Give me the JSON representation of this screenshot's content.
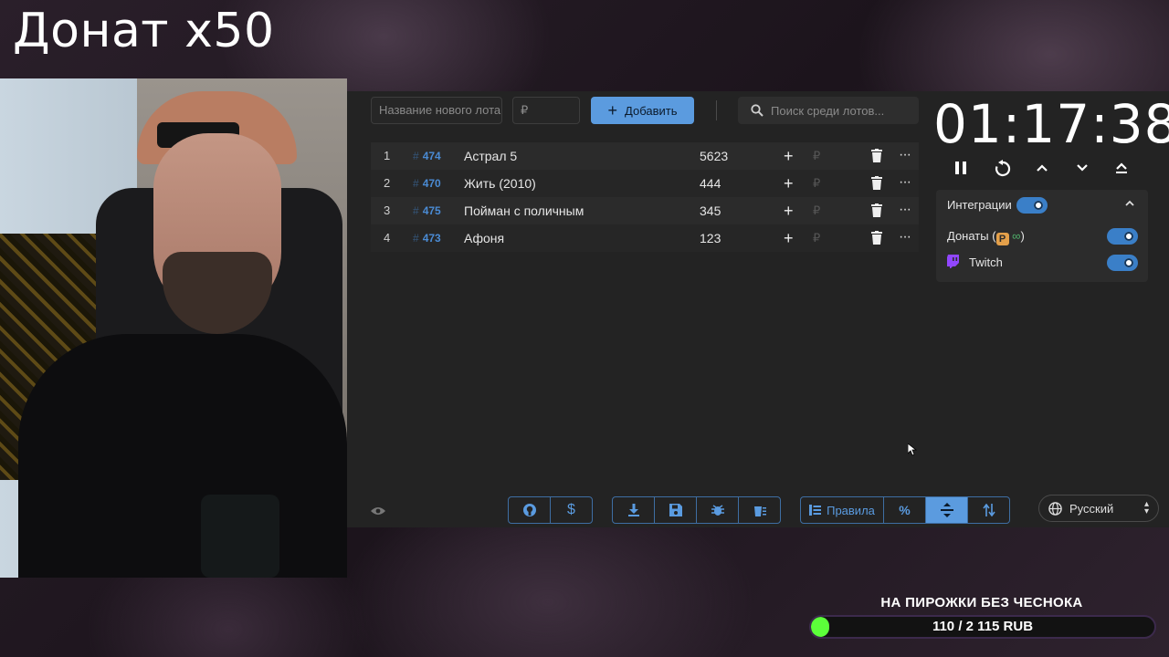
{
  "overlay": {
    "title": "Донат x50"
  },
  "toolbar": {
    "new_lot_placeholder": "Название нового лота",
    "amount_placeholder": "₽",
    "add_label": "Добавить",
    "search_placeholder": "Поиск среди лотов..."
  },
  "lots": [
    {
      "index": "1",
      "id": "474",
      "name": "Астрал 5",
      "amount": "5623"
    },
    {
      "index": "2",
      "id": "470",
      "name": "Жить (2010)",
      "amount": "444"
    },
    {
      "index": "3",
      "id": "475",
      "name": "Пойман с поличным",
      "amount": "345"
    },
    {
      "index": "4",
      "id": "473",
      "name": "Афоня",
      "amount": "123"
    }
  ],
  "row_actions": {
    "plus": "+",
    "currency": "₽",
    "more": "···"
  },
  "timer": {
    "value": "01:17:38"
  },
  "integrations": {
    "title": "Интеграции",
    "donations_label": "Донаты (",
    "donations_suffix": ")",
    "twitch_label": "Twitch",
    "enabled": true,
    "donations_enabled": true,
    "twitch_enabled": true
  },
  "bottom": {
    "rules_label": "Правила",
    "percent_label": "%",
    "language": "Русский"
  },
  "goal": {
    "title": "НА ПИРОЖКИ БЕЗ ЧЕСНОКА",
    "progress_text": "110 / 2 115 RUB",
    "progress_fraction": 0.052
  },
  "colors": {
    "accent": "#5b9bdf",
    "tag": "#4a8bd4",
    "goal_fill": "#5cff3a",
    "twitch": "#9146ff"
  },
  "icons": [
    "plus-icon",
    "search-icon",
    "trash-icon",
    "more-icon",
    "pause-icon",
    "restart-icon",
    "chevron-up-icon",
    "chevron-down-icon",
    "eject-icon",
    "github-icon",
    "dollar-icon",
    "download-icon",
    "save-icon",
    "bug-icon",
    "clear-icon",
    "list-icon",
    "percent-icon",
    "split-icon",
    "sort-icon",
    "globe-icon",
    "eye-icon",
    "twitch-icon"
  ]
}
